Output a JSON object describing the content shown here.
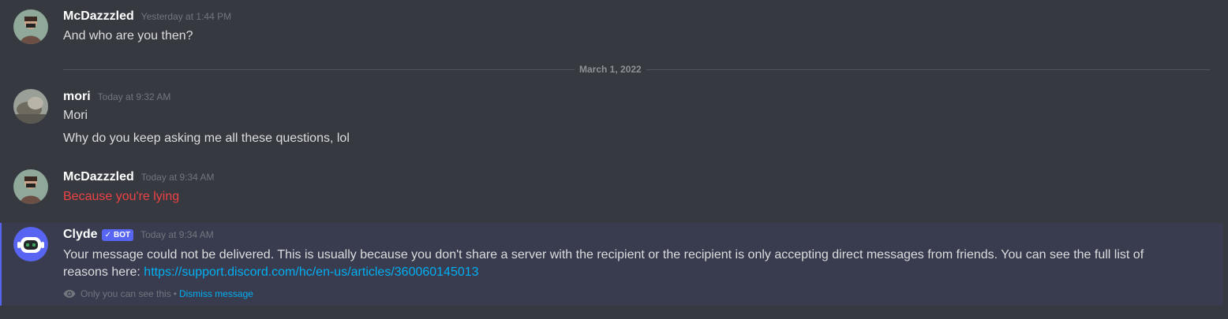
{
  "messages": [
    {
      "author": "McDazzzled",
      "timestamp": "Yesterday at 1:44 PM",
      "lines": [
        "And who are you then?"
      ]
    },
    {
      "author": "mori",
      "timestamp": "Today at 9:32 AM",
      "lines": [
        "Mori",
        "Why do you keep asking me all these questions, lol"
      ]
    },
    {
      "author": "McDazzzled",
      "timestamp": "Today at 9:34 AM",
      "lines": [
        "Because you're lying"
      ]
    }
  ],
  "divider": {
    "label": "March 1, 2022"
  },
  "clyde": {
    "author": "Clyde",
    "badge": "BOT",
    "timestamp": "Today at 9:34 AM",
    "text": "Your message could not be delivered. This is usually because you don't share a server with the recipient or the recipient is only accepting direct messages from friends. You can see the full list of reasons here:",
    "link": "https://support.discord.com/hc/en-us/articles/360060145013",
    "note": "Only you can see this",
    "separator": "•",
    "dismiss": "Dismiss message"
  },
  "colors": {
    "background": "#36393f",
    "ephemeral_bg": "#383c4e",
    "accent": "#5865f2",
    "link": "#00aff4",
    "error_text": "#ed4245"
  }
}
